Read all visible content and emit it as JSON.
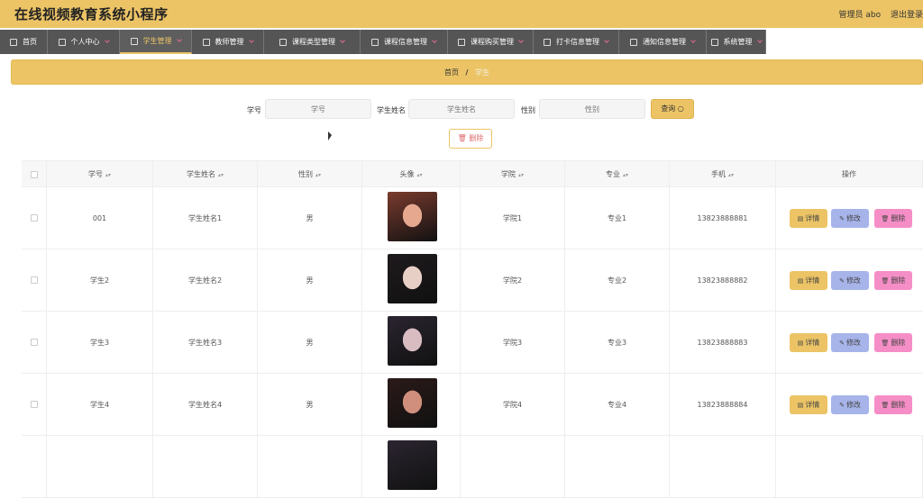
{
  "app_title": "在线视频教育系统小程序",
  "user": {
    "label": "管理员 abo",
    "logout": "退出登录"
  },
  "nav": [
    {
      "label": "首页",
      "icon": "home-icon",
      "active": false
    },
    {
      "label": "个人中心",
      "icon": "user-icon",
      "active": false
    },
    {
      "label": "学生管理",
      "icon": "card-icon",
      "active": true
    },
    {
      "label": "教师管理",
      "icon": "pin-icon",
      "active": false
    },
    {
      "label": "课程类型管理",
      "icon": "crop-icon",
      "active": false
    },
    {
      "label": "课程信息管理",
      "icon": "list-icon",
      "active": false
    },
    {
      "label": "课程购买管理",
      "icon": "cart-icon",
      "active": false
    },
    {
      "label": "打卡信息管理",
      "icon": "frame-icon",
      "active": false
    },
    {
      "label": "通知信息管理",
      "icon": "send-icon",
      "active": false
    },
    {
      "label": "系统管理",
      "icon": "gear-icon",
      "active": false
    }
  ],
  "breadcrumb": {
    "home": "首页",
    "sep": "/",
    "current": "学生"
  },
  "search": {
    "id_label": "学号",
    "id_placeholder": "学号",
    "name_label": "学生姓名",
    "name_placeholder": "学生姓名",
    "gender_label": "性别",
    "gender_placeholder": "性别",
    "query": "查询"
  },
  "delete_label": "删除",
  "columns": [
    "学号",
    "学生姓名",
    "性别",
    "头像",
    "学院",
    "专业",
    "手机",
    "操作"
  ],
  "actions": {
    "detail": "详情",
    "edit": "修改",
    "remove": "删除"
  },
  "rows": [
    {
      "id": "001",
      "name": "学生姓名1",
      "gender": "男",
      "college": "学院1",
      "major": "专业1",
      "phone": "13823888881"
    },
    {
      "id": "学生2",
      "name": "学生姓名2",
      "gender": "男",
      "college": "学院2",
      "major": "专业2",
      "phone": "13823888882"
    },
    {
      "id": "学生3",
      "name": "学生姓名3",
      "gender": "男",
      "college": "学院3",
      "major": "专业3",
      "phone": "13823888883"
    },
    {
      "id": "学生4",
      "name": "学生姓名4",
      "gender": "男",
      "college": "学院4",
      "major": "专业4",
      "phone": "13823888884"
    }
  ],
  "colors": {
    "accent": "#ecc466",
    "nav": "#555555",
    "edit": "#a7b4ea",
    "remove": "#f58ec6"
  }
}
